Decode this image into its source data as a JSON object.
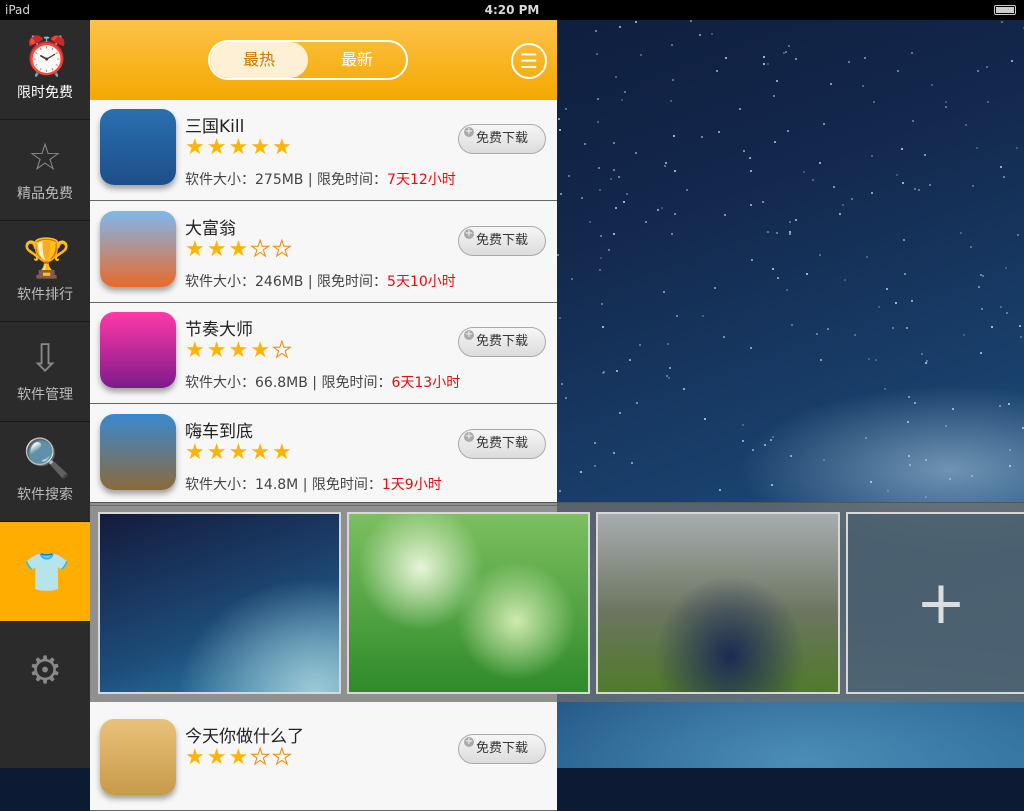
{
  "status_bar": {
    "device": "iPad",
    "time": "4:20 PM"
  },
  "sidebar": {
    "items": [
      {
        "label": "限时免费",
        "icon": "alarm-clock-icon"
      },
      {
        "label": "精品免费",
        "icon": "star-icon"
      },
      {
        "label": "软件排行",
        "icon": "trophy-icon"
      },
      {
        "label": "软件管理",
        "icon": "download-box-icon"
      },
      {
        "label": "软件搜索",
        "icon": "search-icon"
      },
      {
        "label": "",
        "icon": "tshirt-icon",
        "selected": true
      },
      {
        "label": "",
        "icon": "gear-icon"
      }
    ]
  },
  "header": {
    "tabs": [
      "最热",
      "最新"
    ],
    "active_tab": "最热",
    "menu_icon": "menu-icon"
  },
  "apps": [
    {
      "name": "三国Kill",
      "rating": 5,
      "size_label": "软件大小：",
      "size": "275MB",
      "sep": " | ",
      "time_label": "限免时间：",
      "time": "7天12小时",
      "button": "免费下载"
    },
    {
      "name": "大富翁",
      "rating": 3,
      "size_label": "软件大小：",
      "size": "246MB",
      "sep": " | ",
      "time_label": "限免时间：",
      "time": "5天10小时",
      "button": "免费下载"
    },
    {
      "name": "节奏大师",
      "rating": 4,
      "size_label": "软件大小：",
      "size": "66.8MB",
      "sep": " | ",
      "time_label": "限免时间：",
      "time": "6天13小时",
      "button": "免费下载"
    },
    {
      "name": "嗨车到底",
      "rating": 5,
      "size_label": "软件大小：",
      "size": "14.8M",
      "sep": " | ",
      "time_label": "限免时间：",
      "time": "1天9小时",
      "button": "免费下载"
    },
    {
      "name": "今天你做什么了",
      "rating": 3,
      "button": "免费下载"
    }
  ],
  "wallpapers": {
    "items": [
      "starry-sky",
      "green-bokeh",
      "water-pour"
    ],
    "add_icon": "plus-icon"
  },
  "colors": {
    "accent": "#ffae00",
    "time_red": "#e01010"
  }
}
